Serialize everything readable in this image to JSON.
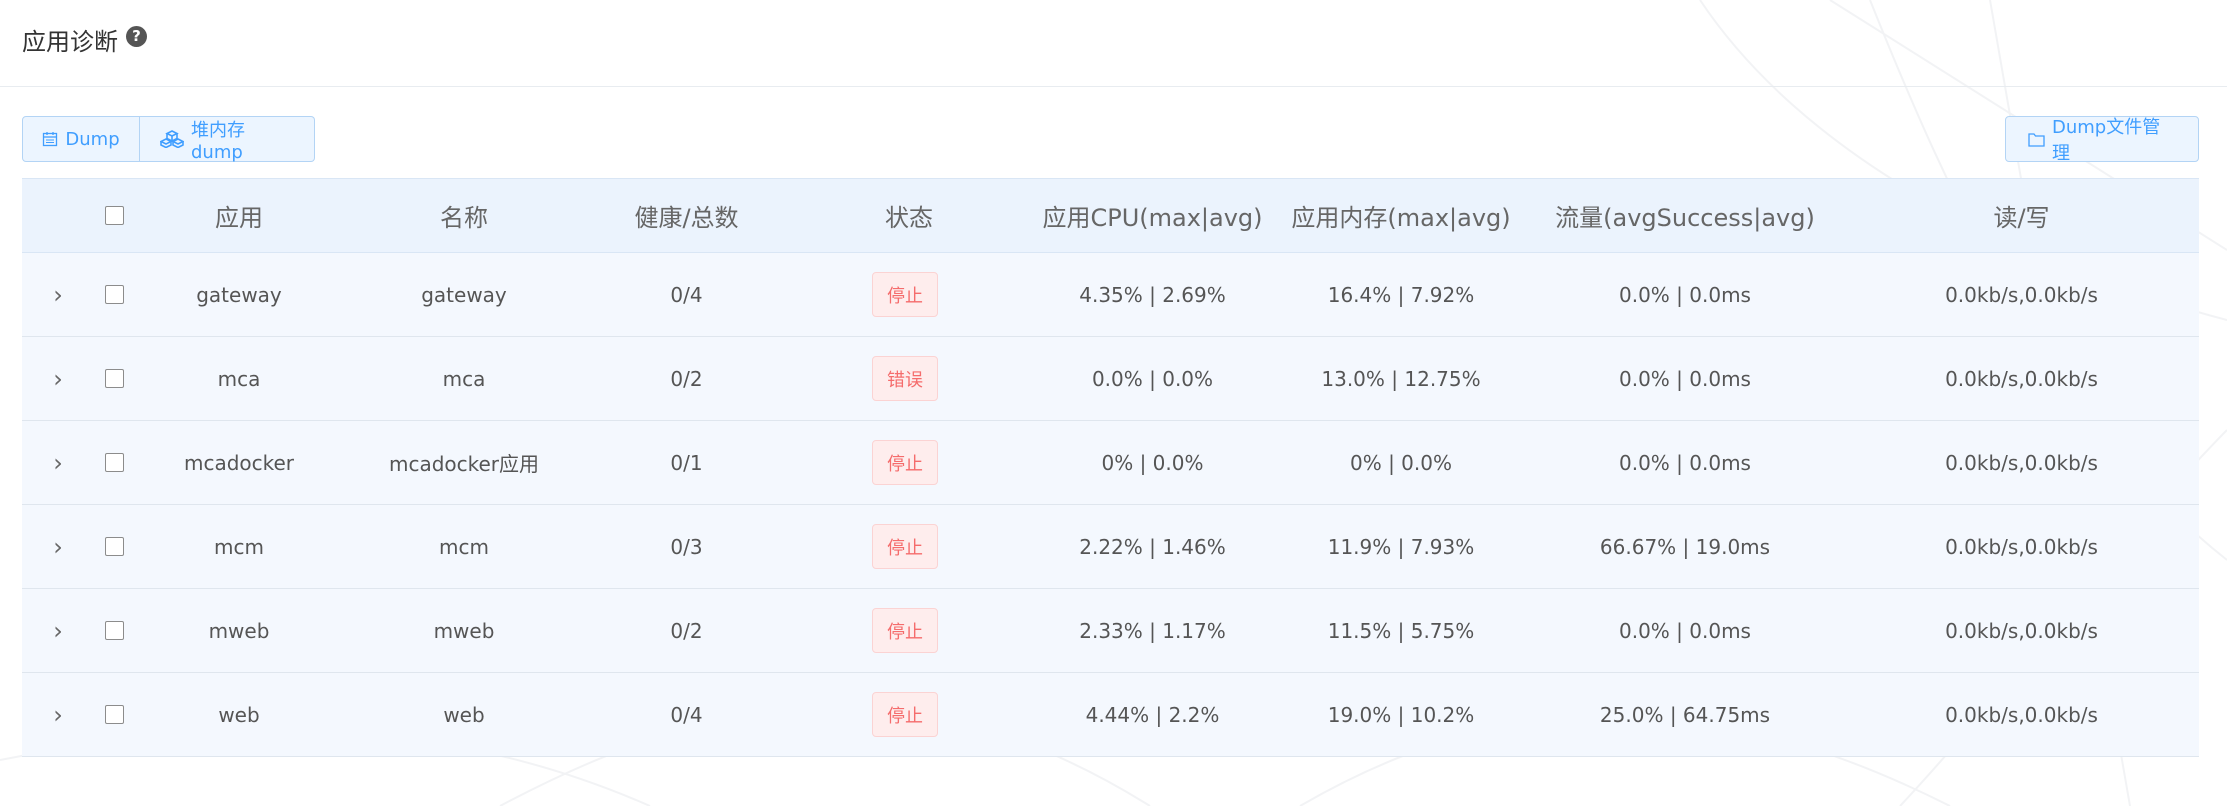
{
  "header": {
    "title": "应用诊断",
    "help_icon": "?"
  },
  "toolbar": {
    "dump_label": "Dump",
    "heap_dump_label": "堆内存dump",
    "dump_manage_label": "Dump文件管理"
  },
  "colors": {
    "accent": "#409eff",
    "header_bg": "#ebf3fd",
    "row_bg": "#f4f8fe",
    "status_error": "#f56c6c"
  },
  "table": {
    "columns": [
      "应用",
      "名称",
      "健康/总数",
      "状态",
      "应用CPU(max|avg)",
      "应用内存(max|avg)",
      "流量(avgSuccess|avg)",
      "读/写"
    ],
    "rows": [
      {
        "app": "gateway",
        "name": "gateway",
        "health": "0/4",
        "status": "停止",
        "cpu": "4.35% | 2.69%",
        "mem": "16.4% | 7.92%",
        "flow": "0.0% | 0.0ms",
        "rw": "0.0kb/s,0.0kb/s"
      },
      {
        "app": "mca",
        "name": "mca",
        "health": "0/2",
        "status": "错误",
        "cpu": "0.0% | 0.0%",
        "mem": "13.0% | 12.75%",
        "flow": "0.0% | 0.0ms",
        "rw": "0.0kb/s,0.0kb/s"
      },
      {
        "app": "mcadocker",
        "name": "mcadocker应用",
        "health": "0/1",
        "status": "停止",
        "cpu": "0% | 0.0%",
        "mem": "0% | 0.0%",
        "flow": "0.0% | 0.0ms",
        "rw": "0.0kb/s,0.0kb/s"
      },
      {
        "app": "mcm",
        "name": "mcm",
        "health": "0/3",
        "status": "停止",
        "cpu": "2.22% | 1.46%",
        "mem": "11.9% | 7.93%",
        "flow": "66.67% | 19.0ms",
        "rw": "0.0kb/s,0.0kb/s"
      },
      {
        "app": "mweb",
        "name": "mweb",
        "health": "0/2",
        "status": "停止",
        "cpu": "2.33% | 1.17%",
        "mem": "11.5% | 5.75%",
        "flow": "0.0% | 0.0ms",
        "rw": "0.0kb/s,0.0kb/s"
      },
      {
        "app": "web",
        "name": "web",
        "health": "0/4",
        "status": "停止",
        "cpu": "4.44% | 2.2%",
        "mem": "19.0% | 10.2%",
        "flow": "25.0% | 64.75ms",
        "rw": "0.0kb/s,0.0kb/s"
      }
    ]
  }
}
